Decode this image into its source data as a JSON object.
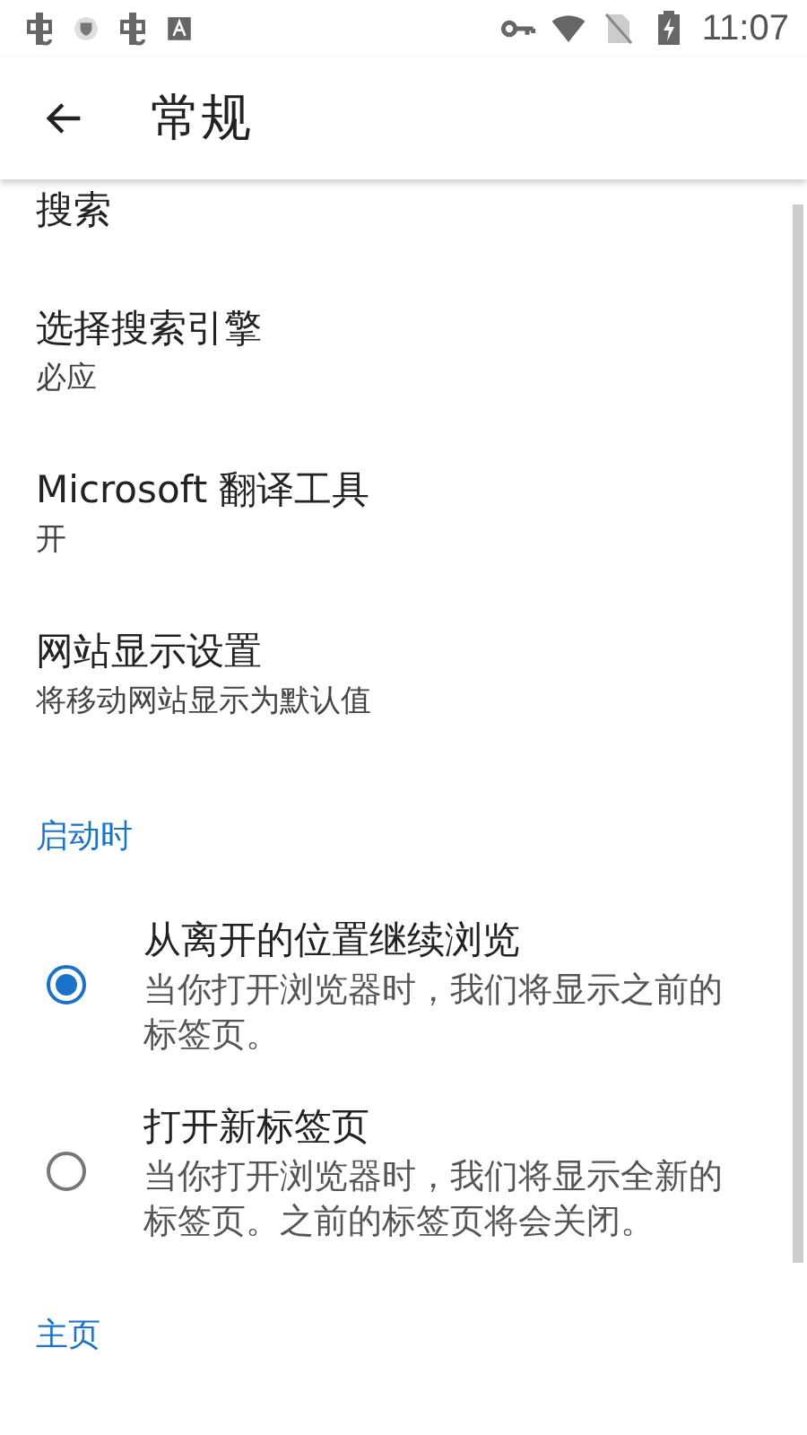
{
  "status_bar": {
    "time": "11:07"
  },
  "toolbar": {
    "title": "常规"
  },
  "items": [
    {
      "title": "搜索"
    },
    {
      "title": "选择搜索引擎",
      "subtitle": "必应"
    },
    {
      "title": "Microsoft 翻译工具",
      "subtitle": "开"
    },
    {
      "title": "网站显示设置",
      "subtitle": "将移动网站显示为默认值"
    }
  ],
  "startup": {
    "header": "启动时",
    "options": [
      {
        "title": "从离开的位置继续浏览",
        "description": "当你打开浏览器时，我们将显示之前的标签页。",
        "selected": true
      },
      {
        "title": "打开新标签页",
        "description": "当你打开浏览器时，我们将显示全新的标签页。之前的标签页将会关闭。",
        "selected": false
      }
    ]
  },
  "homepage": {
    "header": "主页"
  }
}
